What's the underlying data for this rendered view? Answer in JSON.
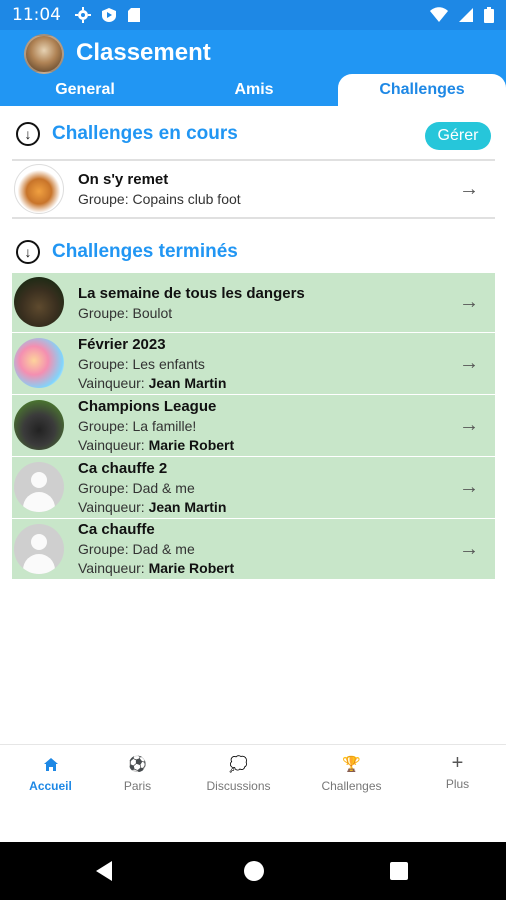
{
  "status_bar": {
    "time": "11:04",
    "left_icons": [
      "gear-icon",
      "play-shield-icon",
      "sd-card-icon"
    ],
    "right_icons": [
      "wifi-icon",
      "signal-icon",
      "battery-icon"
    ]
  },
  "header": {
    "title": "Classement",
    "tabs": [
      {
        "label": "General"
      },
      {
        "label": "Amis"
      },
      {
        "label": "Challenges"
      }
    ]
  },
  "current": {
    "title": "Challenges en cours",
    "manage_label": "Gérer",
    "items": [
      {
        "name": "On s'y remet",
        "group_label": "Groupe:",
        "group": "Copains club foot"
      }
    ]
  },
  "finished": {
    "title": "Challenges terminés",
    "winner_label": "Vainqueur:",
    "items": [
      {
        "name": "La semaine de tous les dangers",
        "group_label": "Groupe:",
        "group": "Boulot"
      },
      {
        "name": "Février 2023",
        "group_label": "Groupe:",
        "group": "Les enfants",
        "winner": "Jean Martin"
      },
      {
        "name": "Champions League",
        "group_label": "Groupe:",
        "group": "La famille!",
        "winner": "Marie Robert"
      },
      {
        "name": "Ca chauffe 2",
        "group_label": "Groupe:",
        "group": "Dad & me",
        "winner": "Jean Martin"
      },
      {
        "name": "Ca chauffe",
        "group_label": "Groupe:",
        "group": "Dad & me",
        "winner": "Marie Robert"
      }
    ]
  },
  "bottom_nav": [
    {
      "label": "Accueil",
      "icon": "home-icon",
      "active": true
    },
    {
      "label": "Paris",
      "icon": "soccer-ball-icon"
    },
    {
      "label": "Discussions",
      "icon": "chat-icon"
    },
    {
      "label": "Challenges",
      "icon": "trophy-icon"
    },
    {
      "label": "Plus",
      "icon": "plus-icon"
    }
  ],
  "colors": {
    "primary": "#2196f3",
    "status_bar": "#1e88e5",
    "manage_button": "#26c6da",
    "finished_row_bg": "#c8e6c9"
  }
}
